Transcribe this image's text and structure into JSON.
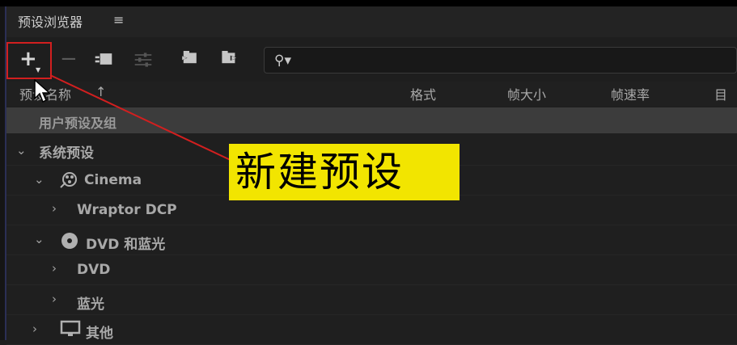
{
  "panel": {
    "title": "预设浏览器",
    "menu_icon": "≡"
  },
  "toolbar": {
    "new_button_icon": "plus-icon",
    "delete_button_icon": "minus-icon",
    "search_placeholder": ""
  },
  "columns": {
    "name": "预设名称",
    "sort_indicator": "↑",
    "format": "格式",
    "frame_size": "帧大小",
    "frame_rate": "帧速率",
    "target": "目标"
  },
  "tree": {
    "user_group": "用户预设及组",
    "system_group": "系统预设",
    "items": [
      {
        "label": "Cinema",
        "icon": "film-reel-icon"
      },
      {
        "label": "Wraptor DCP"
      },
      {
        "label": "DVD 和蓝光",
        "icon": "disc-icon"
      },
      {
        "label": "DVD"
      },
      {
        "label": "蓝光"
      },
      {
        "label": "其他",
        "icon": "monitor-icon"
      }
    ]
  },
  "annotation": {
    "callout_text": "新建预设",
    "highlight_color": "#d21f1f",
    "callout_bg": "#f2e500"
  }
}
